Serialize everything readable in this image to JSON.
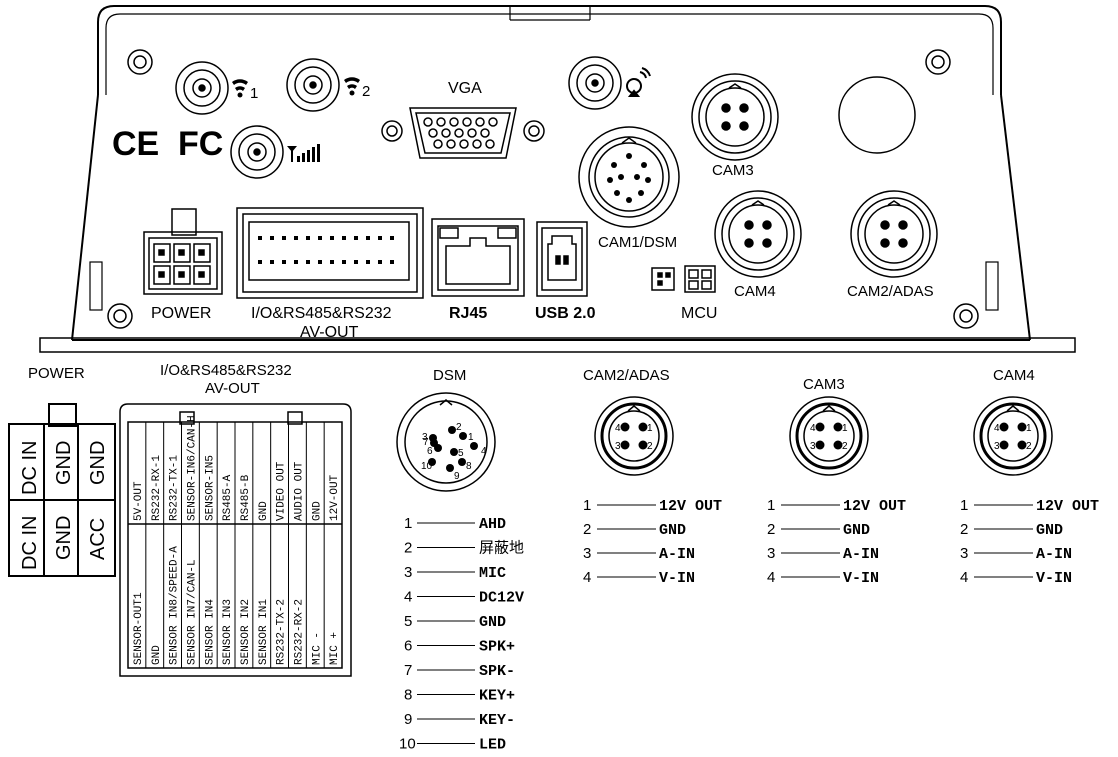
{
  "panel": {
    "wifi1_num": "1",
    "wifi2_num": "2",
    "vga_label": "VGA",
    "ce_mark": "CE",
    "fcc_mark": "FC",
    "cam3_label": "CAM3",
    "cam1dsm_label": "CAM1/DSM",
    "cam4_label": "CAM4",
    "cam2adas_label": "CAM2/ADAS",
    "power_label": "POWER",
    "io_label_line1": "I/O&RS485&RS232",
    "io_label_line2": "AV-OUT",
    "rj45_label": "RJ45",
    "usb_label": "USB 2.0",
    "mcu_label": "MCU"
  },
  "power_pinout": {
    "title": "POWER",
    "columns": [
      [
        "DC IN",
        "DC IN"
      ],
      [
        "GND",
        "GND"
      ],
      [
        "GND",
        "ACC"
      ]
    ]
  },
  "io_pinout": {
    "title_line1": "I/O&RS485&RS232",
    "title_line2": "AV-OUT",
    "top_row": [
      "5V-OUT",
      "RS232-RX-1",
      "RS232-TX-1",
      "SENSOR-IN6/CAN-H",
      "SENSOR-IN5",
      "RS485-A",
      "RS485-B",
      "GND",
      "VIDEO OUT",
      "AUDIO OUT",
      "GND",
      "12V-OUT"
    ],
    "bottom_row": [
      "SENSOR-OUT1",
      "GND",
      "SENSOR IN8/SPEED-A",
      "SENSOR IN7/CAN-L",
      "SENSOR IN4",
      "SENSOR IN3",
      "SENSOR IN2",
      "SENSOR IN1",
      "RS232-TX-2",
      "RS232-RX-2",
      "MIC -",
      "MIC +"
    ]
  },
  "dsm": {
    "title": "DSM",
    "pins": [
      {
        "num": "1",
        "label": "AHD"
      },
      {
        "num": "2",
        "label": "屏蔽地"
      },
      {
        "num": "3",
        "label": "MIC"
      },
      {
        "num": "4",
        "label": "DC12V"
      },
      {
        "num": "5",
        "label": "GND"
      },
      {
        "num": "6",
        "label": "SPK+"
      },
      {
        "num": "7",
        "label": "SPK-"
      },
      {
        "num": "8",
        "label": "KEY+"
      },
      {
        "num": "9",
        "label": "KEY-"
      },
      {
        "num": "10",
        "label": "LED"
      }
    ],
    "connector_nums": [
      "1",
      "2",
      "3",
      "4",
      "5",
      "6",
      "7",
      "8",
      "9",
      "10"
    ]
  },
  "cams": [
    {
      "title": "CAM2/ADAS",
      "pins": [
        {
          "num": "1",
          "label": "12V OUT"
        },
        {
          "num": "2",
          "label": "GND"
        },
        {
          "num": "3",
          "label": "A-IN"
        },
        {
          "num": "4",
          "label": "V-IN"
        }
      ]
    },
    {
      "title": "CAM3",
      "pins": [
        {
          "num": "1",
          "label": "12V OUT"
        },
        {
          "num": "2",
          "label": "GND"
        },
        {
          "num": "3",
          "label": "A-IN"
        },
        {
          "num": "4",
          "label": "V-IN"
        }
      ]
    },
    {
      "title": "CAM4",
      "pins": [
        {
          "num": "1",
          "label": "12V OUT"
        },
        {
          "num": "2",
          "label": "GND"
        },
        {
          "num": "3",
          "label": "A-IN"
        },
        {
          "num": "4",
          "label": "V-IN"
        }
      ]
    }
  ],
  "cam_connector_nums": [
    "4",
    "1",
    "3",
    "2"
  ]
}
